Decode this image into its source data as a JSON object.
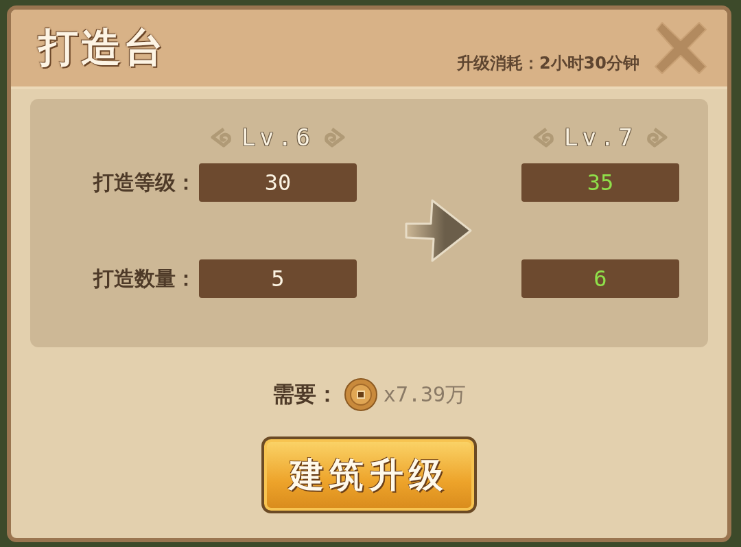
{
  "window": {
    "title": "打造台",
    "upgrade_cost": "升级消耗：2小时30分钟"
  },
  "levels": {
    "current": "Lv.6",
    "next": "Lv.7"
  },
  "stats": [
    {
      "label": "打造等级：",
      "current": "30",
      "next": "35"
    },
    {
      "label": "打造数量：",
      "current": "5",
      "next": "6"
    }
  ],
  "requirement": {
    "label": "需要：",
    "amount": "x7.39万"
  },
  "upgrade_button": "建筑升级"
}
